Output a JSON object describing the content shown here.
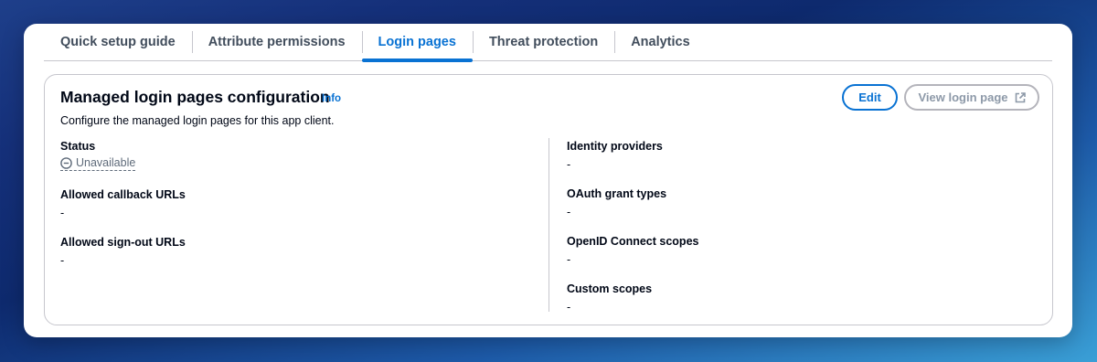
{
  "tabs": [
    {
      "label": "Quick setup guide"
    },
    {
      "label": "Attribute permissions"
    },
    {
      "label": "Login pages",
      "active": true
    },
    {
      "label": "Threat protection"
    },
    {
      "label": "Analytics"
    }
  ],
  "card": {
    "title": "Managed login pages configuration",
    "info_label": "Info",
    "description": "Configure the managed login pages for this app client.",
    "edit_label": "Edit",
    "view_login_label": "View login page",
    "view_login_icon": "external-link-icon"
  },
  "left_fields": {
    "status": {
      "label": "Status",
      "value": "Unavailable",
      "icon": "unavailable-icon"
    },
    "callback": {
      "label": "Allowed callback URLs",
      "value": "-"
    },
    "signout": {
      "label": "Allowed sign-out URLs",
      "value": "-"
    }
  },
  "right_fields": {
    "identity": {
      "label": "Identity providers",
      "value": "-"
    },
    "oauth": {
      "label": "OAuth grant types",
      "value": "-"
    },
    "openid": {
      "label": "OpenID Connect scopes",
      "value": "-"
    },
    "custom": {
      "label": "Custom scopes",
      "value": "-"
    }
  },
  "colors": {
    "accent": "#0972d3",
    "text": "#000716",
    "muted": "#5f6b7a",
    "border": "#c6c6cd"
  }
}
